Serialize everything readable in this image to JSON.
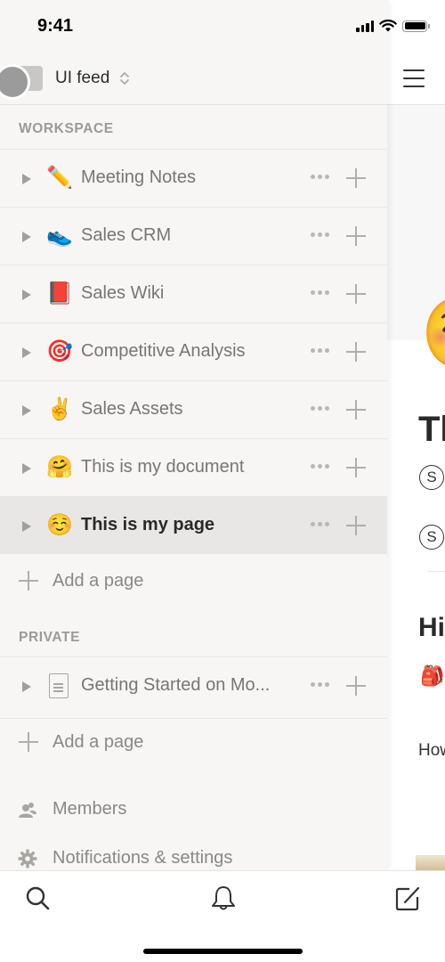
{
  "status_bar": {
    "time": "9:41"
  },
  "workspace": {
    "name": "UI feed"
  },
  "sections": {
    "workspace_label": "WORKSPACE",
    "private_label": "PRIVATE"
  },
  "workspace_pages": [
    {
      "emoji": "✏️",
      "label": "Meeting Notes",
      "selected": false
    },
    {
      "emoji": "👟",
      "label": "Sales CRM",
      "selected": false
    },
    {
      "emoji": "📕",
      "label": "Sales Wiki",
      "selected": false
    },
    {
      "emoji": "🎯",
      "label": "Competitive Analysis",
      "selected": false
    },
    {
      "emoji": "✌️",
      "label": "Sales Assets",
      "selected": false
    },
    {
      "emoji": "🤗",
      "label": "This is my document",
      "selected": false
    },
    {
      "emoji": "☺️",
      "label": "This is my page",
      "selected": true
    }
  ],
  "private_pages": [
    {
      "icon": "document-icon",
      "label": "Getting Started on Mo..."
    }
  ],
  "add_page_label": "Add a page",
  "bottom_links": {
    "members": "Members",
    "settings": "Notifications & settings"
  },
  "content_peek": {
    "page_emoji": "☺️",
    "title_fragment": "Th",
    "property_glyph": "S",
    "heading_fragment": "Hi",
    "block_emoji": "🎒",
    "body_fragment": "How"
  },
  "tabbar": {
    "items": [
      "search-icon",
      "bell-icon",
      "compose-icon"
    ]
  }
}
